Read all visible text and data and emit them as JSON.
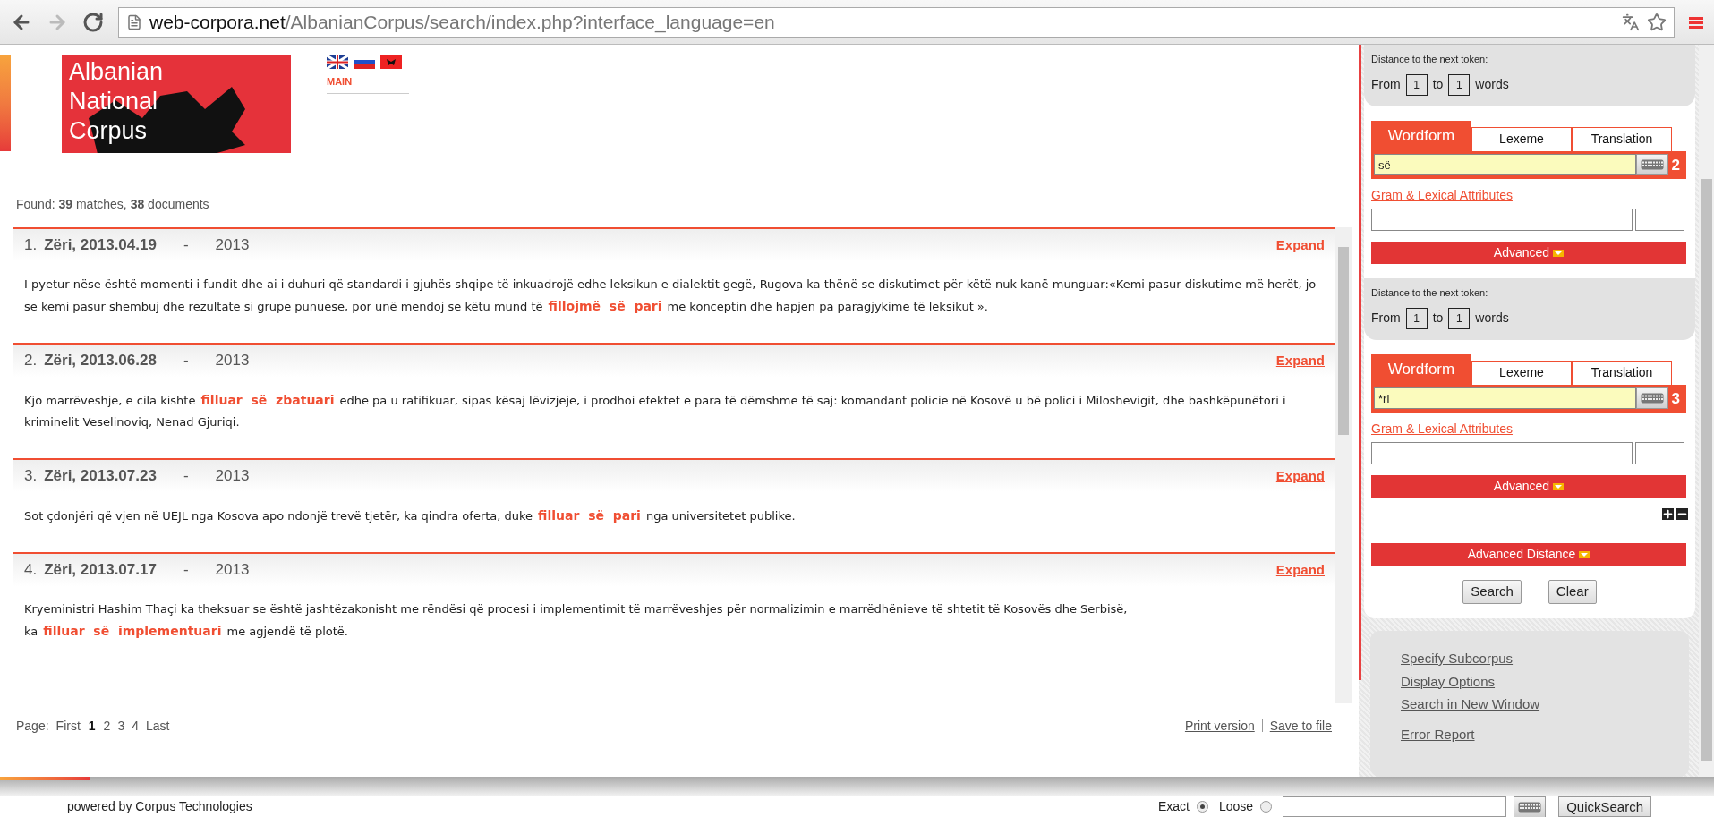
{
  "browser": {
    "url_host": "web-corpora.net",
    "url_path": "/AlbanianCorpus/search/index.php?interface_language=en"
  },
  "header": {
    "logo_lines": [
      "Albanian",
      "National",
      "Corpus"
    ],
    "nav": "MAIN"
  },
  "found": "Found: **39** matches, **38** documents",
  "results": [
    {
      "number": "1.",
      "source": "Zëri, 2013.04.19",
      "separator": "-",
      "year": "2013",
      "expand": "Expand",
      "parts": [
        {
          "text": "I pyetur nëse është momenti i fundit dhe ai i duhuri që standardi i gjuhës shqipe të inkuadrojë edhe leksikun e dialektit gegë, Rugova ka thënë se diskutimet për këtë nuk kanë munguar:«Kemi pasur diskutime më herët, jo se kemi pasur shembuj dhe rezultate si grupe punuese, por unë mendoj se këtu mund të",
          "hit": false
        },
        {
          "text": "fillojmë  së  pari",
          "hit": true
        },
        {
          "text": "me konceptin dhe hapjen pa paragjykime të leksikut ».",
          "hit": false
        }
      ]
    },
    {
      "number": "2.",
      "source": "Zëri, 2013.06.28",
      "separator": "-",
      "year": "2013",
      "expand": "Expand",
      "parts": [
        {
          "text": "Kjo marrëveshje, e cila kishte",
          "hit": false
        },
        {
          "text": "filluar  së  zbatuari",
          "hit": true
        },
        {
          "text": "edhe pa u ratifikuar, sipas kësaj lëvizjeje, i prodhoi efektet e para të dëmshme të saj: komandant policie në Kosovë u bë polici i Miloshevigit, dhe bashkëpunëtori i kriminelit Veselinoviq, Nenad Gjuriqi.",
          "hit": false
        }
      ]
    },
    {
      "number": "3.",
      "source": "Zëri, 2013.07.23",
      "separator": "-",
      "year": "2013",
      "expand": "Expand",
      "parts": [
        {
          "text": "Sot çdonjëri që vjen në UEJL nga Kosova apo ndonjë trevë tjetër, ka qindra oferta, duke",
          "hit": false
        },
        {
          "text": "filluar  së  pari",
          "hit": true
        },
        {
          "text": "nga universitetet publike.",
          "hit": false
        }
      ]
    },
    {
      "number": "4.",
      "source": "Zëri, 2013.07.17",
      "separator": "-",
      "year": "2013",
      "expand": "Expand",
      "parts": [
        {
          "text": "Kryeministri Hashim Thaçi ka theksuar se është jashtëzakonisht me rëndësi që procesi i implementimit të marrëveshjes për normalizimin e marrëdhënieve të shtetit të Kosovës dhe Serbisë, ka",
          "hit": false
        },
        {
          "text": "filluar  së  implementuari",
          "hit": true
        },
        {
          "text": "me agjendë të plotë.",
          "hit": false
        }
      ]
    }
  ],
  "pager": {
    "label": "Page:",
    "items": [
      {
        "text": "First",
        "selected": false
      },
      {
        "text": "1",
        "selected": true
      },
      {
        "text": "2",
        "selected": false
      },
      {
        "text": "3",
        "selected": false
      },
      {
        "text": "4",
        "selected": false
      },
      {
        "text": "Last",
        "selected": false
      }
    ]
  },
  "result_links": [
    "Print version",
    "Save to file"
  ],
  "panel": {
    "tokens": [
      {
        "distance": {
          "label": "Distance to the next token:",
          "from_label": "From",
          "from": "1",
          "to_label": "to",
          "to": "1",
          "unit": "words"
        },
        "tabs": [
          {
            "label": "Wordform",
            "selected": true
          },
          {
            "label": "Lexeme",
            "selected": false
          },
          {
            "label": "Translation",
            "selected": false
          }
        ],
        "value": "së",
        "number": "2",
        "attributes_link": "Gram & Lexical Attributes",
        "advanced": "Advanced"
      },
      {
        "distance": {
          "label": "Distance to the next token:",
          "from_label": "From",
          "from": "1",
          "to_label": "to",
          "to": "1",
          "unit": "words"
        },
        "tabs": [
          {
            "label": "Wordform",
            "selected": true
          },
          {
            "label": "Lexeme",
            "selected": false
          },
          {
            "label": "Translation",
            "selected": false
          }
        ],
        "value": "*ri",
        "number": "3",
        "attributes_link": "Gram & Lexical Attributes",
        "advanced": "Advanced"
      }
    ],
    "advanced_distance": "Advanced Distance",
    "buttons": [
      "Search",
      "Clear"
    ],
    "links": [
      "Specify Subcorpus",
      "Display Options",
      "Search in New Window",
      "Error Report"
    ]
  },
  "footer": {
    "powered": "powered by Corpus Technologies",
    "modes": [
      {
        "label": "Exact",
        "selected": true
      },
      {
        "label": "Loose",
        "selected": false
      }
    ],
    "quicksearch": "QuickSearch"
  }
}
